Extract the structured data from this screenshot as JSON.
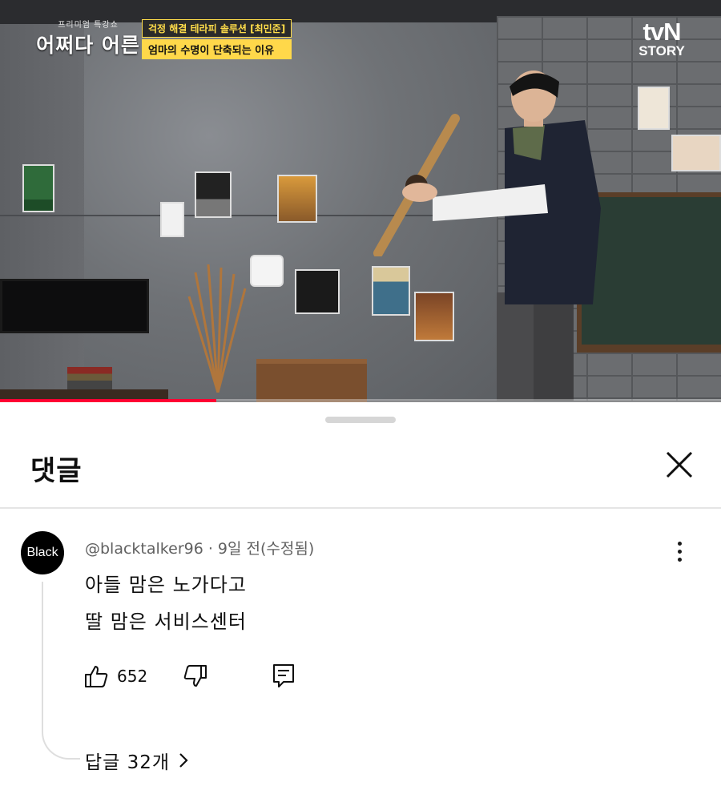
{
  "video": {
    "show_title_small": "프리미엄 특강쇼",
    "show_title": "어쩌다 어른",
    "caption_top": "걱정 해결 테라피 솔루션 [최민준]",
    "caption_bottom": "엄마의 수명이 단축되는 이유",
    "channel_line1": "tvN",
    "channel_line2": "STORY",
    "progress_fraction": 0.3
  },
  "comments_panel": {
    "title": "댓글",
    "close_icon": "close-icon"
  },
  "comment": {
    "avatar_text": "Black",
    "author": "@blacktalker96",
    "meta": "@blacktalker96 · 9일 전(수정됨)",
    "text_line1": "아들 맘은 노가다고",
    "text_line2": "딸 맘은 서비스센터",
    "like_count": "652",
    "replies_label": "답글 32개",
    "icons": [
      "thumbs-up-icon",
      "thumbs-down-icon",
      "reply-icon",
      "more-vertical-icon",
      "chevron-right-icon"
    ]
  },
  "colors": {
    "progress": "#ff0033",
    "caption_yellow": "#ffd84a",
    "text_primary": "#0f0f0f",
    "text_secondary": "#606060"
  }
}
